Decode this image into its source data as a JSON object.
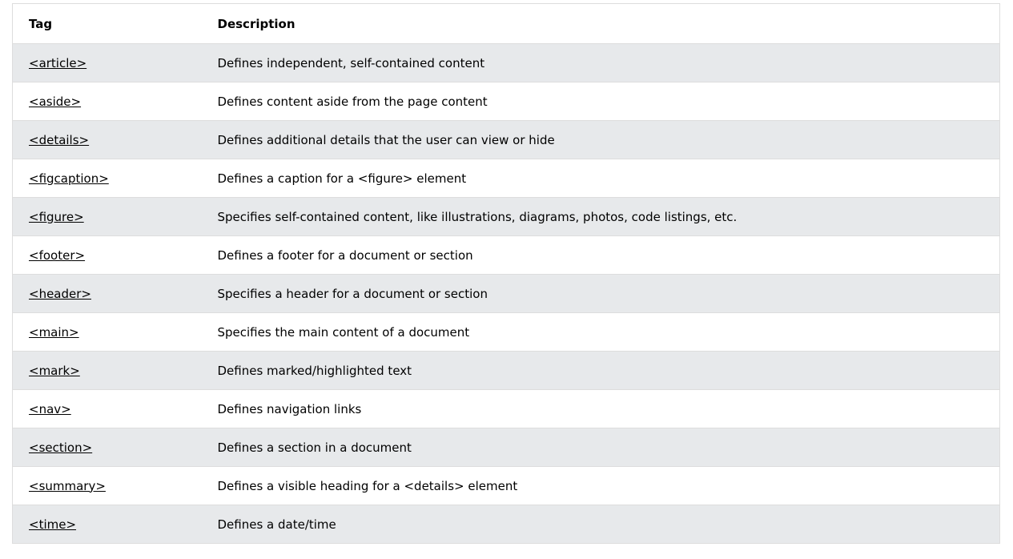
{
  "table": {
    "headers": [
      "Tag",
      "Description"
    ],
    "rows": [
      {
        "tag": "<article>",
        "description": "Defines independent, self-contained content"
      },
      {
        "tag": "<aside>",
        "description": "Defines content aside from the page content"
      },
      {
        "tag": "<details>",
        "description": "Defines additional details that the user can view or hide"
      },
      {
        "tag": "<figcaption>",
        "description": "Defines a caption for a <figure> element"
      },
      {
        "tag": "<figure>",
        "description": "Specifies self-contained content, like illustrations, diagrams, photos, code listings, etc."
      },
      {
        "tag": "<footer>",
        "description": "Defines a footer for a document or section"
      },
      {
        "tag": "<header>",
        "description": "Specifies a header for a document or section"
      },
      {
        "tag": "<main>",
        "description": "Specifies the main content of a document"
      },
      {
        "tag": "<mark>",
        "description": "Defines marked/highlighted text"
      },
      {
        "tag": "<nav>",
        "description": "Defines navigation links"
      },
      {
        "tag": "<section>",
        "description": "Defines a section in a document"
      },
      {
        "tag": "<summary>",
        "description": "Defines a visible heading for a <details> element"
      },
      {
        "tag": "<time>",
        "description": "Defines a date/time"
      }
    ]
  },
  "colors": {
    "stripe": "#E7E9EB",
    "border": "#DDDDDD"
  }
}
